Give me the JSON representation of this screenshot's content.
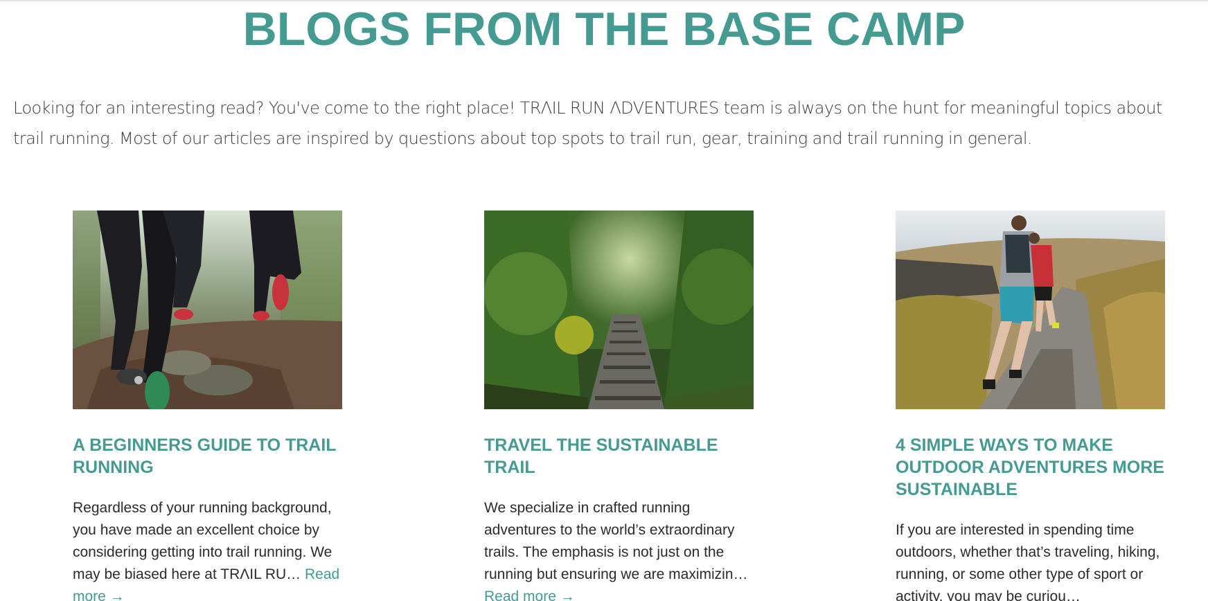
{
  "header": {
    "title": "BLOGS FROM THE BASE CAMP"
  },
  "intro": {
    "text": "Looking for an interesting read? You've come to the right place! TRΛIL RUN ΛDVENTURES team is always on the hunt for meaningful topics about trail running. Most of our articles are inspired by questions about top spots to trail run, gear, training and trail running in general."
  },
  "posts": [
    {
      "title": "A BEGINNERS GUIDE TO TRAIL RUNNING",
      "excerpt": "Regardless of your running background, you have made an excellent choice by considering getting into trail running. We may be biased here at TRΛIL RU… ",
      "read_more": "Read more →",
      "image": "trail-runners-legs-photo"
    },
    {
      "title": "TRAVEL THE SUSTAINABLE TRAIL",
      "excerpt": "We specialize in crafted running adventures to the world’s extraordinary trails. The emphasis is not just on the running but ensuring we are maximizin… ",
      "read_more": "Read more →",
      "image": "forest-stairs-photo"
    },
    {
      "title": "4 SIMPLE WAYS TO MAKE OUTDOOR ADVENTURES MORE SUSTAINABLE",
      "excerpt": "If you are interested in spending time outdoors, whether that’s traveling, hiking, running, or some other type of sport or activity, you may be curiou…",
      "read_more": "",
      "image": "moorland-runners-photo"
    }
  ],
  "colors": {
    "accent": "#459a92",
    "text": "#2b2b2b"
  }
}
